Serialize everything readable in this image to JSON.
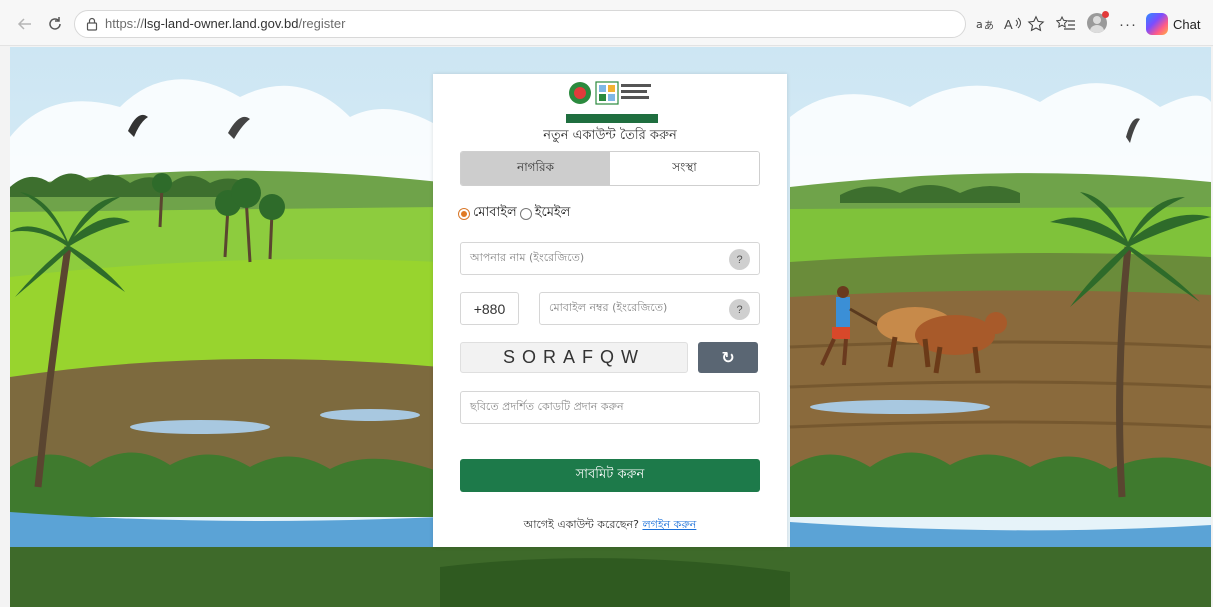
{
  "browser": {
    "url_protocol": "https://",
    "url_host": "lsg-land-owner.land.gov.bd",
    "url_path": "/register",
    "chat_label": "Chat"
  },
  "logo": {
    "line1": "ভূমি ব্যবস্থাপনা অটোমেশন প্রকল্প",
    "line2": "ভূমি মন্ত্রণালয়"
  },
  "form": {
    "title": "নতুন একাউন্ট তৈরি করুন",
    "tabs": [
      {
        "label": "নাগরিক",
        "active": true
      },
      {
        "label": "সংস্থা",
        "active": false
      }
    ],
    "radio_mobile": "মোবাইল",
    "radio_email": "ইমেইল",
    "name_placeholder": "আপনার নাম (ইংরেজিতে)",
    "help_symbol": "?",
    "phone_prefix": "+880",
    "phone_placeholder": "মোবাইল নম্বর (ইংরেজিতে)",
    "captcha_text": "SORAFQW",
    "refresh_symbol": "↻",
    "code_placeholder": "ছবিতে প্রদর্শিত কোডটি প্রদান করুন",
    "submit_label": "সাবমিট করুন",
    "footer_text": "আগেই একাউন্ট করেছেন?",
    "login_link": "লগইন করুন"
  },
  "colors": {
    "submit_green": "#1d7a4a",
    "radio_orange": "#e07a24",
    "refresh_gray": "#5a6673",
    "link_blue": "#1a6fd8"
  }
}
